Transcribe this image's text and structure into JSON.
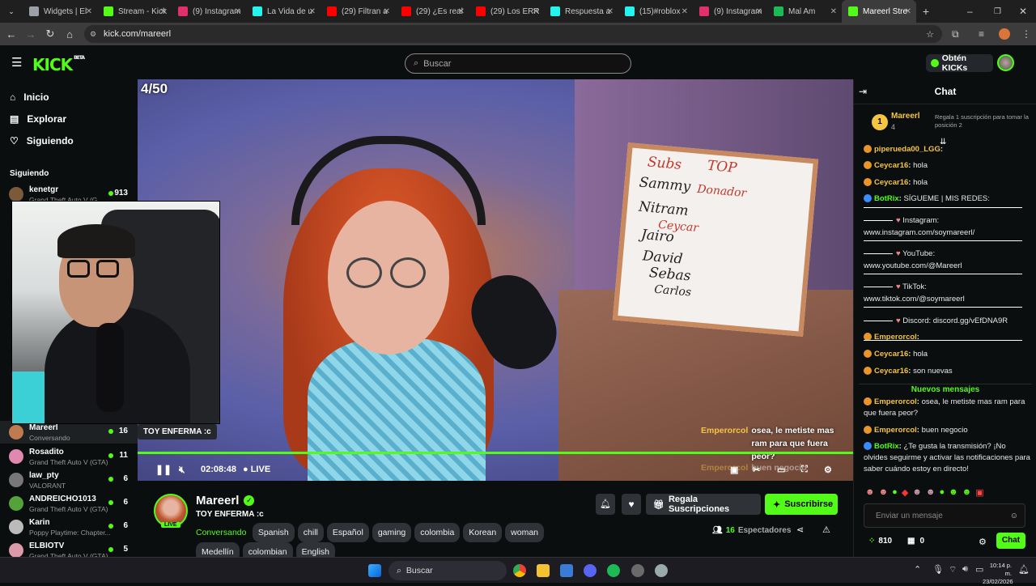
{
  "browser": {
    "tabs": [
      {
        "label": "Widgets | El",
        "color": "#9aa0a6"
      },
      {
        "label": "Stream - Kick",
        "color": "#53fc18"
      },
      {
        "label": "(9) Instagram",
        "color": "#e1306c"
      },
      {
        "label": "La Vida de u",
        "color": "#25f4ee"
      },
      {
        "label": "(29) Filtran a",
        "color": "#ff0000"
      },
      {
        "label": "(29) ¿Es real",
        "color": "#ff0000"
      },
      {
        "label": "(29) Los ERR",
        "color": "#ff0000"
      },
      {
        "label": "Respuesta a",
        "color": "#25f4ee"
      },
      {
        "label": "(15)#roblox",
        "color": "#25f4ee"
      },
      {
        "label": "(9) Instagram",
        "color": "#e1306c"
      },
      {
        "label": "Mal Am",
        "color": "#1db954"
      },
      {
        "label": "Mareerl Stre",
        "color": "#53fc18"
      }
    ],
    "url": "kick.com/mareerl"
  },
  "header": {
    "logo": "KICK",
    "beta": "BETA",
    "search_placeholder": "Buscar",
    "get_kicks": "Obtén KICKs"
  },
  "sidebar": {
    "nav": [
      {
        "label": "Inicio",
        "icon": "home-icon"
      },
      {
        "label": "Explorar",
        "icon": "compass-icon"
      },
      {
        "label": "Siguiendo",
        "icon": "heart-icon"
      }
    ],
    "following_title": "Siguiendo",
    "following": [
      {
        "name": "kenetgr",
        "game": "Grand Theft Auto V (G",
        "count": "913"
      },
      {
        "name": "Mareerl",
        "game": "Conversando",
        "count": "16"
      },
      {
        "name": "Rosadito",
        "game": "Grand Theft Auto V (GTA)",
        "count": "11"
      },
      {
        "name": "law_pty",
        "game": "VALORANT",
        "count": "6"
      },
      {
        "name": "ANDREICHO1013",
        "game": "Grand Theft Auto V (GTA)",
        "count": "6"
      },
      {
        "name": "Karin",
        "game": "Poppy Playtime: Chapter...",
        "count": "6"
      },
      {
        "name": "ELBIOTV",
        "game": "Grand Theft Auto V (GTA)",
        "count": "5"
      }
    ]
  },
  "player": {
    "counter": "4/50",
    "board": [
      "Subs",
      "TOP",
      "Sammy",
      "Donador",
      "Nitram",
      "Ceycar",
      "Jairo",
      "David",
      "Sebas",
      "Carlos"
    ],
    "stream_title_chip": "TOY ENFERMA :c",
    "time": "02:08:48",
    "live": "LIVE",
    "overlay_user": "Emperorcol",
    "overlay_msg": "osea, le metiste mas ram para que fuera peor?",
    "overlay_user2": "Emperorcol",
    "overlay_msg2": "buen negocio",
    "progress": 1.0
  },
  "channel": {
    "name": "Mareerl",
    "title": "TOY ENFERMA :c",
    "category": "Conversando",
    "live_badge": "LIVE",
    "tags": [
      "Spanish",
      "chill",
      "Español",
      "gaming",
      "colombia",
      "Korean",
      "woman",
      "Medellín",
      "colombian",
      "English"
    ],
    "gift_label": "Regala Suscripciones",
    "subscribe_label": "Suscribirse",
    "viewers": "16",
    "viewers_label": "Espectadores"
  },
  "chat": {
    "title": "Chat",
    "pinned_user": "Mareerl",
    "pinned_rank": "1",
    "pinned_count": "4",
    "pinned_hint": "Regala 1 suscripción para tomar la posición 2",
    "messages": [
      {
        "user": "piperueda00_LGG",
        "text": ""
      },
      {
        "user": "Ceycar16",
        "text": "hola"
      },
      {
        "user": "Ceycar16",
        "text": "hola"
      },
      {
        "user": "BotRix",
        "text": "SÍGUEME | MIS REDES:"
      },
      {
        "user": "",
        "text": "Instagram:"
      },
      {
        "user": "",
        "text": "www.instagram.com/soymareerl/"
      },
      {
        "user": "",
        "text": "YouTube:"
      },
      {
        "user": "",
        "text": "www.youtube.com/@Mareerl"
      },
      {
        "user": "",
        "text": "TikTok:"
      },
      {
        "user": "",
        "text": "www.tiktok.com/@soymareerl"
      },
      {
        "user": "",
        "text": "Discord: discord.gg/vEfDNA9R"
      },
      {
        "user": "Emperorcol",
        "text": ""
      },
      {
        "user": "Ceycar16",
        "text": "hola"
      },
      {
        "user": "Ceycar16",
        "text": "son nuevas"
      },
      {
        "user": "Emperorcol",
        "text": "osea, le metiste mas ram para que fuera peor?"
      },
      {
        "user": "Emperorcol",
        "text": "buen negocio"
      },
      {
        "user": "BotRix",
        "text": "¿Te gusta la transmisión? ¡No olvides seguirme y activar las notificaciones para saber cuándo estoy en directo!"
      }
    ],
    "new_messages": "Nuevos mensajes",
    "input_placeholder": "Enviar un mensaje",
    "points": "810",
    "gifts": "0",
    "send_label": "Chat"
  },
  "taskbar": {
    "search": "Buscar",
    "time": "10:14 p. m.",
    "date": "23/02/2026"
  },
  "colors": {
    "accent": "#53fc18",
    "bg": "#0b0e0f"
  }
}
